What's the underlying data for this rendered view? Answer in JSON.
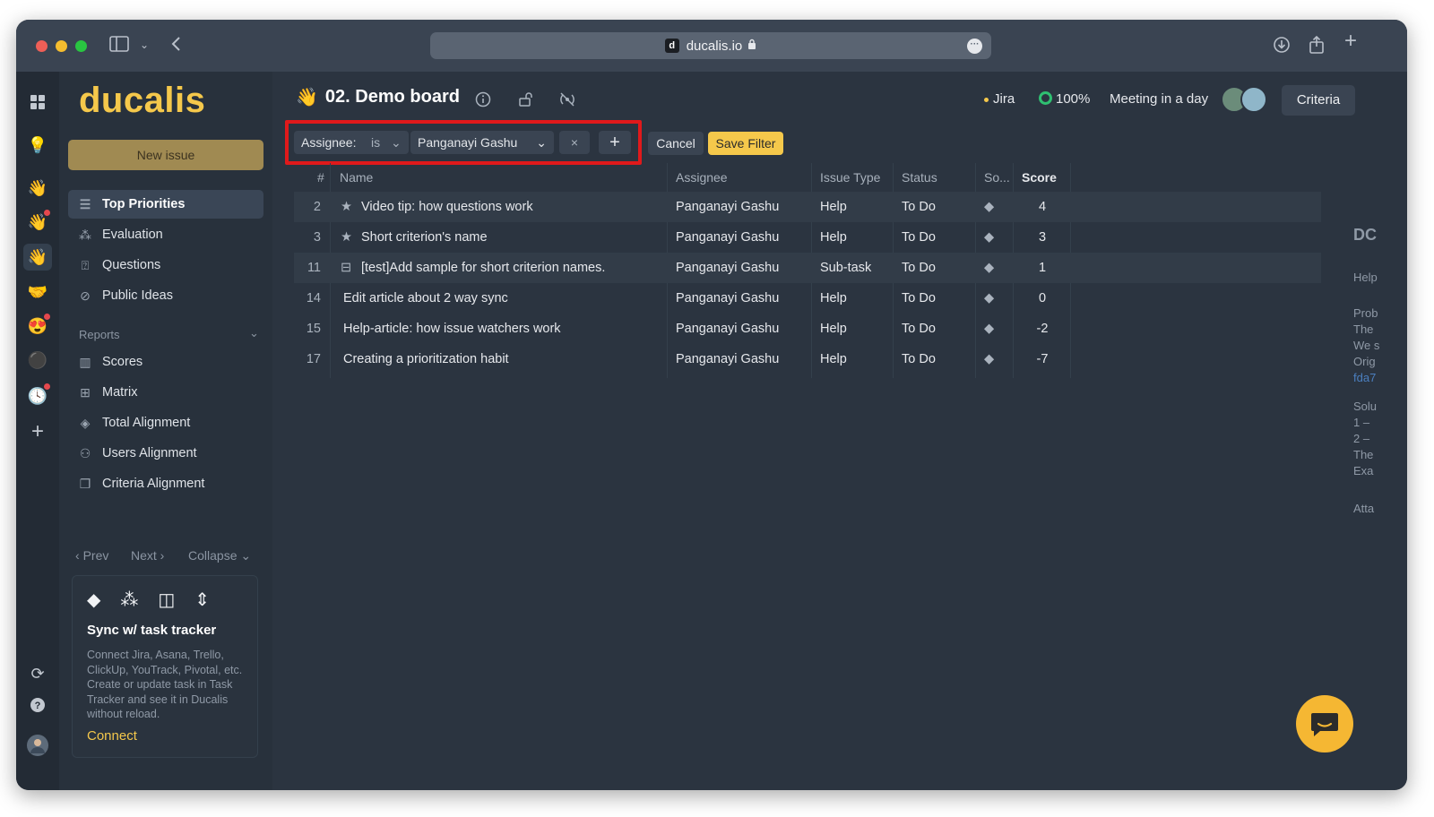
{
  "browser": {
    "url": "ducalis.io",
    "favicon_letter": "d"
  },
  "sidebar": {
    "logo": "ducalis",
    "new_issue": "New issue",
    "items": [
      {
        "label": "Top Priorities",
        "icon": "list-icon"
      },
      {
        "label": "Evaluation",
        "icon": "nodes-icon"
      },
      {
        "label": "Questions",
        "icon": "question-box-icon"
      },
      {
        "label": "Public Ideas",
        "icon": "broadcast-off-icon"
      }
    ],
    "reports_label": "Reports",
    "reports": [
      {
        "label": "Scores",
        "icon": "columns-icon"
      },
      {
        "label": "Matrix",
        "icon": "grid-icon"
      },
      {
        "label": "Total Alignment",
        "icon": "layers-icon"
      },
      {
        "label": "Users Alignment",
        "icon": "users-icon"
      },
      {
        "label": "Criteria Alignment",
        "icon": "copy-icon"
      }
    ],
    "prev": "Prev",
    "next": "Next",
    "collapse": "Collapse",
    "sync": {
      "title": "Sync w/ task tracker",
      "description": "Connect Jira, Asana, Trello, ClickUp, YouTrack, Pivotal, etc. Create or update task in Task Tracker and see it in Ducalis without reload.",
      "connect": "Connect"
    }
  },
  "header": {
    "board_emoji": "👋",
    "board_title": "02. Demo board",
    "jira": "Jira",
    "progress": "100%",
    "meeting": "Meeting in a day",
    "criteria": "Criteria"
  },
  "filter": {
    "field": "Assignee:",
    "operator": "is",
    "value": "Panganayi Gashu",
    "cancel": "Cancel",
    "save": "Save Filter"
  },
  "table": {
    "columns": [
      "#",
      "Name",
      "Assignee",
      "Issue Type",
      "Status",
      "So...",
      "Score"
    ],
    "rows": [
      {
        "num": "2",
        "name": "Video tip: how questions work",
        "icon": "star",
        "assignee": "Panganayi Gashu",
        "type": "Help",
        "status": "To Do",
        "score": "4"
      },
      {
        "num": "3",
        "name": "Short criterion's name",
        "icon": "star",
        "assignee": "Panganayi Gashu",
        "type": "Help",
        "status": "To Do",
        "score": "3"
      },
      {
        "num": "11",
        "name": "[test]Add sample for short criterion names.",
        "icon": "subtask",
        "assignee": "Panganayi Gashu",
        "type": "Sub-task",
        "status": "To Do",
        "score": "1"
      },
      {
        "num": "14",
        "name": "Edit article about 2 way sync",
        "icon": "",
        "assignee": "Panganayi Gashu",
        "type": "Help",
        "status": "To Do",
        "score": "0"
      },
      {
        "num": "15",
        "name": "Help-article: how issue watchers work",
        "icon": "",
        "assignee": "Panganayi Gashu",
        "type": "Help",
        "status": "To Do",
        "score": "-2"
      },
      {
        "num": "17",
        "name": "Creating a prioritization habit",
        "icon": "",
        "assignee": "Panganayi Gashu",
        "type": "Help",
        "status": "To Do",
        "score": "-7"
      }
    ]
  },
  "peek": {
    "lines": [
      "DC",
      "Help",
      "Prob",
      "The",
      "We s",
      "Orig",
      "fda7",
      "Solu",
      "1 –",
      "2 –",
      "The",
      "Exa",
      "Atta"
    ]
  },
  "colors": {
    "accent": "#f5c84b",
    "highlight_box": "#e0191b",
    "progress": "#2fbf71"
  }
}
